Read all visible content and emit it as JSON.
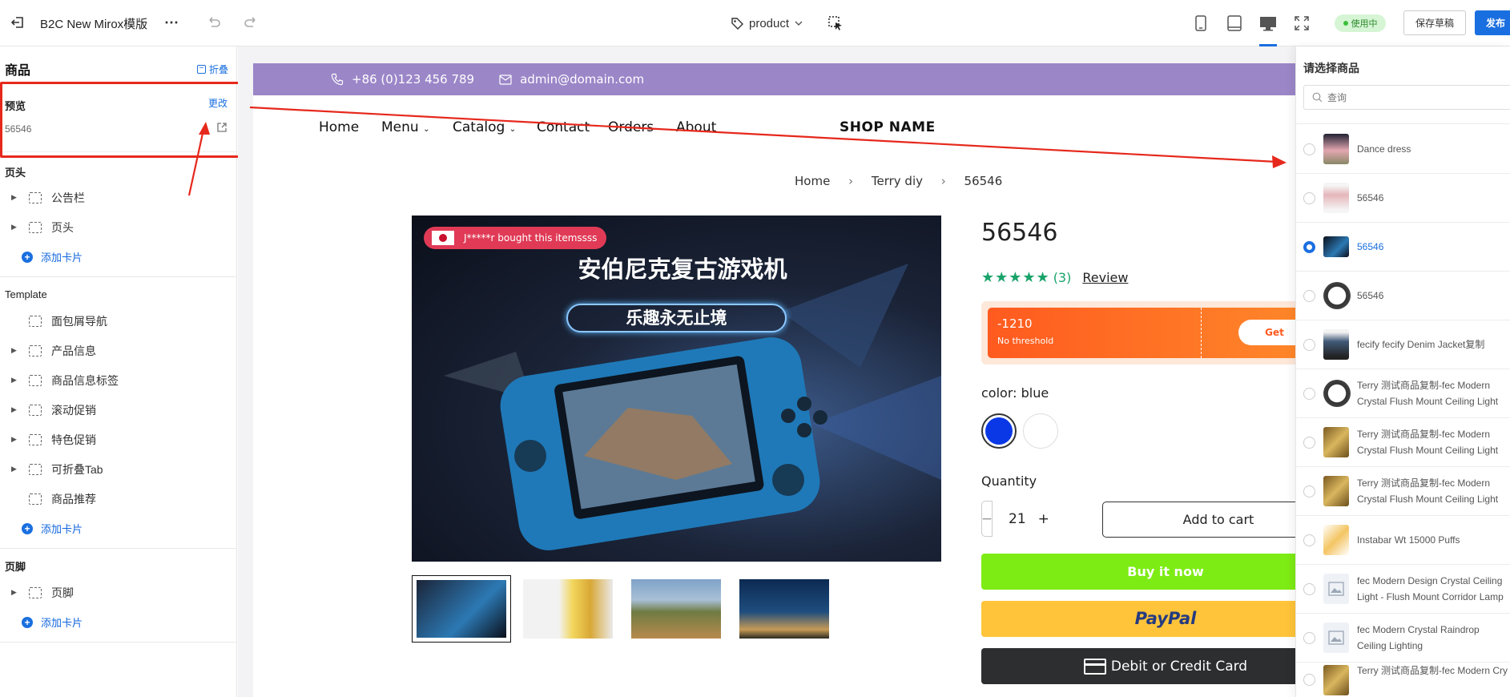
{
  "toolbar": {
    "title": "B2C New Mirox模版",
    "page_selector": "product",
    "status_badge": "使用中",
    "save_draft": "保存草稿",
    "publish": "发布"
  },
  "sidebar": {
    "title": "商品",
    "collapse": "折叠",
    "preview_label": "预览",
    "change": "更改",
    "preview_value": "56546",
    "header_section": "页头",
    "header_items": [
      "公告栏",
      "页头"
    ],
    "add_card": "添加卡片",
    "template_section": "Template",
    "template_items": [
      "面包屑导航",
      "产品信息",
      "商品信息标签",
      "滚动促销",
      "特色促销",
      "可折叠Tab",
      "商品推荐"
    ],
    "footer_section": "页脚",
    "footer_items": [
      "页脚"
    ]
  },
  "store": {
    "phone": "+86 (0)123 456 789",
    "email": "admin@domain.com",
    "nav": [
      "Home",
      "Menu",
      "Catalog",
      "Contact",
      "Orders",
      "About"
    ],
    "shop_name": "SHOP NAME",
    "breadcrumb": [
      "Home",
      "Terry diy",
      "56546"
    ],
    "notice": "J*****r bought this itemssss",
    "image_text_1": "安伯尼克复古游戏机",
    "image_text_2": "乐趣永无止境",
    "product_title": "56546",
    "review_count": "(3)",
    "review_link": "Review",
    "coupon_amount": "-1210",
    "coupon_desc": "No threshold",
    "coupon_btn": "Get",
    "color_label": "color:",
    "color_value": "blue",
    "quantity_label": "Quantity",
    "quantity": "21",
    "add_to_cart": "Add to cart",
    "buy_now": "Buy it now",
    "paypal": "PayPal",
    "debit_card": "Debit or Credit Card",
    "rating": 5,
    "colors": {
      "swatch_blue": "#0a38e6",
      "buy_now": "#7dec14",
      "paypal": "#ffc439",
      "coupon": "#ff6d1f",
      "accent": "#1a6fe0",
      "topbar": "#9b86c8"
    }
  },
  "picker": {
    "title": "请选择商品",
    "search_placeholder": "查询",
    "products": [
      {
        "name": "Dance dress",
        "selected": false
      },
      {
        "name": "56546",
        "selected": false
      },
      {
        "name": "56546",
        "selected": true
      },
      {
        "name": "56546",
        "selected": false
      },
      {
        "name": "fecify fecify Denim Jacket复制",
        "selected": false
      },
      {
        "name": "Terry 测试商品复制-fec Modern Crystal Flush Mount Ceiling Light 下...",
        "selected": false
      },
      {
        "name": "Terry 测试商品复制-fec Modern Crystal Flush Mount Ceiling Light 下...",
        "selected": false
      },
      {
        "name": "Terry 测试商品复制-fec Modern Crystal Flush Mount Ceiling Light 下...",
        "selected": false
      },
      {
        "name": "Instabar Wt 15000 Puffs",
        "selected": false
      },
      {
        "name": "fec Modern Design Crystal Ceiling Light - Flush Mount Corridor Lamp",
        "selected": false
      },
      {
        "name": "fec Modern Crystal Raindrop Ceiling Lighting",
        "selected": false
      },
      {
        "name": "Terry 测试商品复制-fec Modern Cry",
        "selected": false
      }
    ]
  }
}
